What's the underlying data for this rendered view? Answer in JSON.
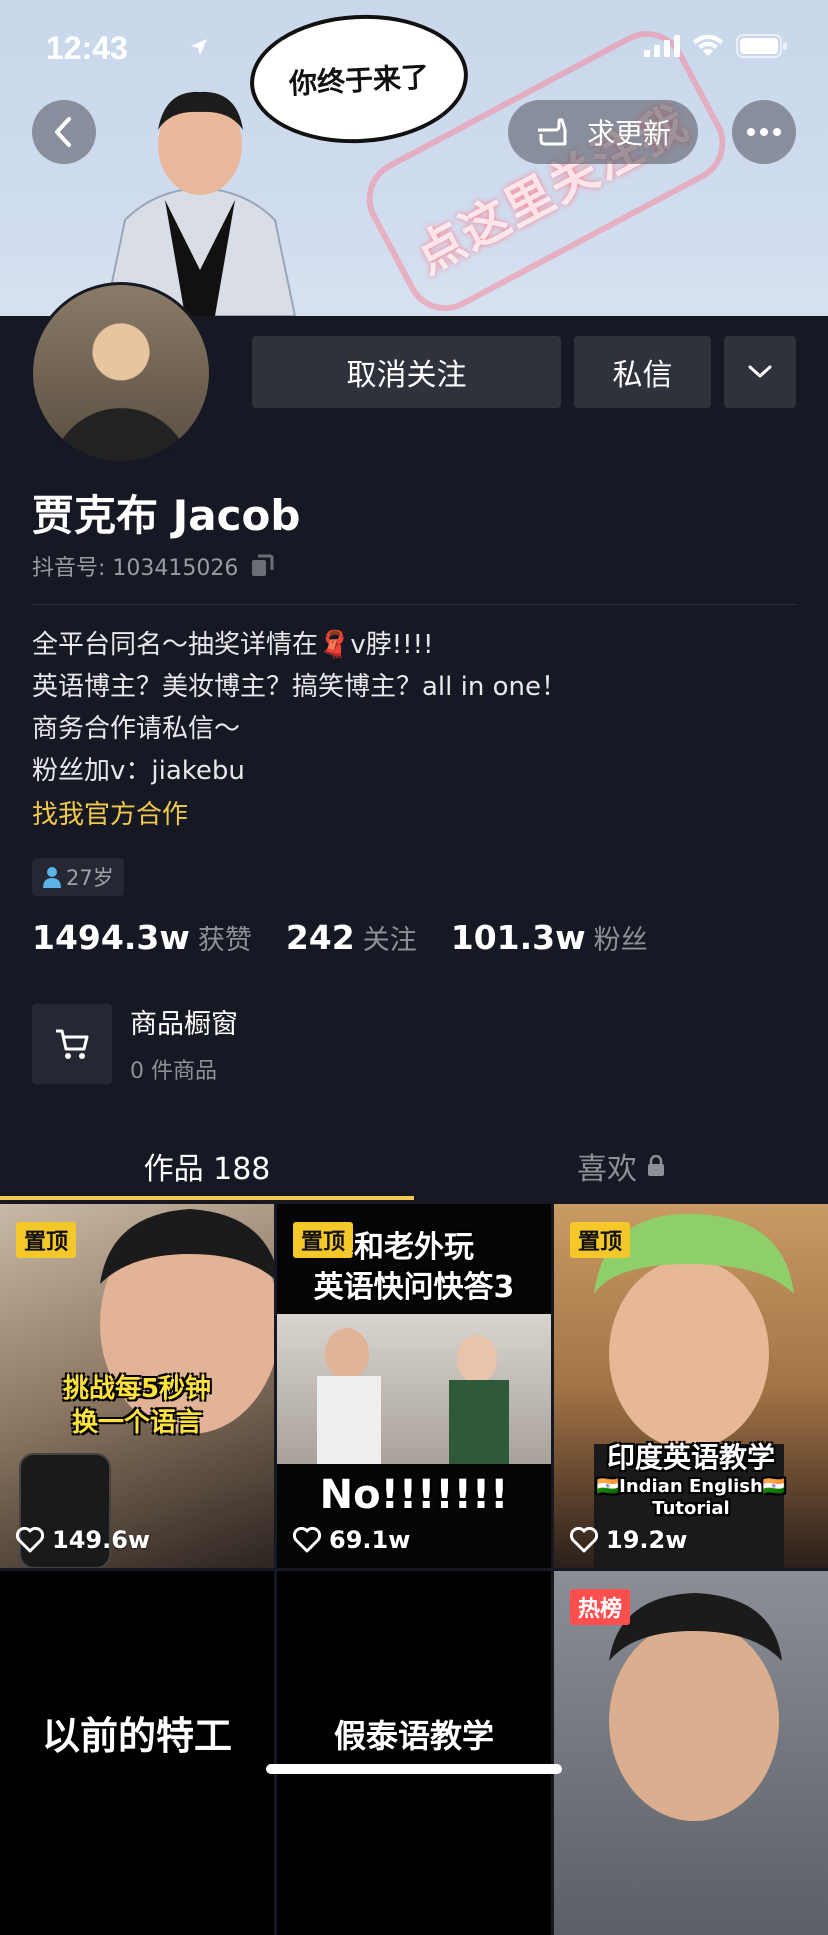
{
  "status": {
    "time": "12:43"
  },
  "banner": {
    "bubble_text": "你终于来了",
    "arrow_text": "点这里关注我",
    "update_label": "求更新"
  },
  "profile": {
    "unfollow_label": "取消关注",
    "message_label": "私信",
    "name": "贾克布 Jacob",
    "id_label": "抖音号: 103415026",
    "bio_lines": [
      "全平台同名～抽奖详情在🧣v脖!!!!",
      "英语博主？美妆博主？搞笑博主？all in one！",
      "商务合作请私信～",
      "粉丝加v：jiakebu"
    ],
    "official_link": "找我官方合作",
    "age": "27岁"
  },
  "stats": {
    "likes_value": "1494.3w",
    "likes_label": "获赞",
    "following_value": "242",
    "following_label": "关注",
    "followers_value": "101.3w",
    "followers_label": "粉丝"
  },
  "shop": {
    "title": "商品橱窗",
    "subtitle": "0 件商品"
  },
  "tabs": {
    "works": "作品 188",
    "likes": "喜欢"
  },
  "videos": [
    {
      "badge": "置顶",
      "caption": "挑战每5秒钟\n换一个语言",
      "likes": "149.6w"
    },
    {
      "badge": "置顶",
      "caption_top": "和老外玩\n英语快问快答3",
      "caption": "No!!!!!!!",
      "likes": "69.1w"
    },
    {
      "badge": "置顶",
      "caption": "印度英语教学",
      "caption_sub": "🇮🇳Indian English🇮🇳\nTutorial",
      "likes": "19.2w"
    },
    {
      "caption": "以前的特工"
    },
    {
      "caption": "假泰语教学"
    },
    {
      "badge": "热榜"
    }
  ],
  "colors": {
    "accent": "#f2c94c",
    "bg": "#161823",
    "button": "#2f313b",
    "hot": "#ff4e4e"
  }
}
